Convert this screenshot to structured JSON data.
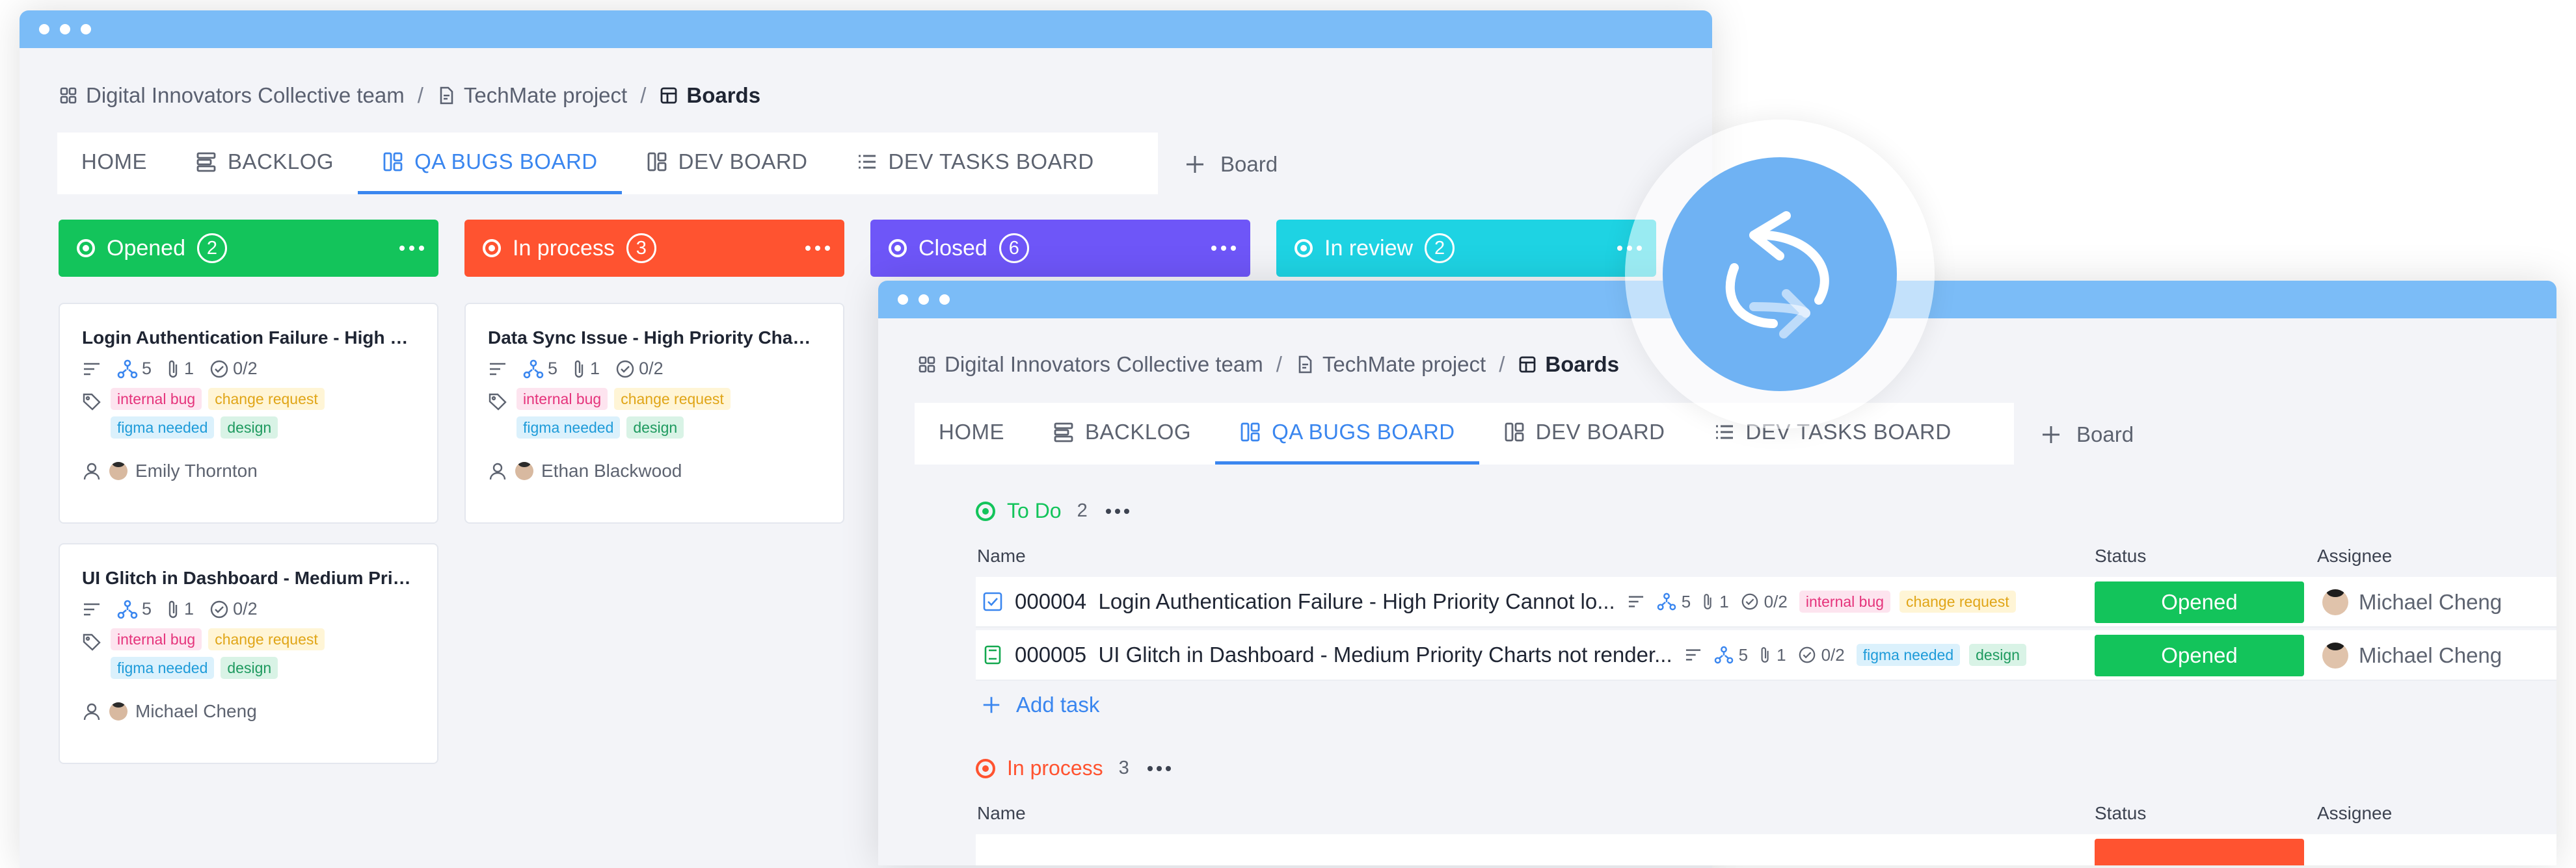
{
  "breadcrumb": {
    "team": "Digital Innovators Collective team",
    "project": "TechMate project",
    "current": "Boards",
    "separator": "/"
  },
  "tabs": [
    "HOME",
    "BACKLOG",
    "QA BUGS BOARD",
    "DEV BOARD",
    "DEV TASKS BOARD"
  ],
  "active_tab": "QA BUGS BOARD",
  "add_board_label": "Board",
  "board": {
    "columns": [
      {
        "title": "Opened",
        "count": "2",
        "color": "#13c45b"
      },
      {
        "title": "In process",
        "count": "3",
        "color": "#ff5330"
      },
      {
        "title": "Closed",
        "count": "6",
        "color": "#6e56f8"
      },
      {
        "title": "In review",
        "count": "2",
        "color": "#1ed3e3"
      }
    ],
    "cards": [
      {
        "title": "Login Authentication Failure - High Pri...",
        "subtasks": "5",
        "attachments": "1",
        "checklist": "0/2",
        "tags": [
          "internal bug",
          "change request",
          "figma needed",
          "design"
        ],
        "owner": "Emily Thornton"
      },
      {
        "title": "Data Sync Issue - High Priority Chang...",
        "subtasks": "5",
        "attachments": "1",
        "checklist": "0/2",
        "tags": [
          "internal bug",
          "change request",
          "figma needed",
          "design"
        ],
        "owner": "Ethan Blackwood"
      },
      {
        "title": "UI Glitch in Dashboard - Medium Prior...",
        "subtasks": "5",
        "attachments": "1",
        "checklist": "0/2",
        "tags": [
          "internal bug",
          "change request",
          "figma needed",
          "design"
        ],
        "owner": "Michael Cheng"
      }
    ]
  },
  "list_view": {
    "columns": {
      "name": "Name",
      "status": "Status",
      "assignee": "Assignee"
    },
    "groups": [
      {
        "title": "To Do",
        "count": "2",
        "color": "#13c45b",
        "rows": [
          {
            "id": "000004",
            "name": "Login Authentication Failure - High Priority Cannot lo...",
            "subtasks": "5",
            "attachments": "1",
            "checklist": "0/2",
            "tags": [
              "internal bug",
              "change request"
            ],
            "status": "Opened",
            "assignee": "Michael Cheng"
          },
          {
            "id": "000005",
            "name": "UI Glitch in Dashboard - Medium Priority Charts not render...",
            "subtasks": "5",
            "attachments": "1",
            "checklist": "0/2",
            "tags": [
              "figma needed",
              "design"
            ],
            "status": "Opened",
            "assignee": "Michael Cheng"
          }
        ],
        "add_task": "Add task"
      },
      {
        "title": "In process",
        "count": "3",
        "color": "#ff5330"
      }
    ]
  },
  "colors": {
    "titlebar": "#7bbcf7",
    "accent": "#3a86ef",
    "status_opened": "#13c45b",
    "status_inprocess": "#ff5330",
    "sync_icon": "#6fb2f3"
  },
  "icons": [
    "team-grid-icon",
    "project-doc-icon",
    "boards-icon",
    "backlog-icon",
    "board-layout-icon",
    "list-icon",
    "plus-icon",
    "sync-icon",
    "tag-icon",
    "user-icon",
    "subtask-icon",
    "attachment-icon",
    "checklist-icon",
    "description-lines-icon"
  ]
}
